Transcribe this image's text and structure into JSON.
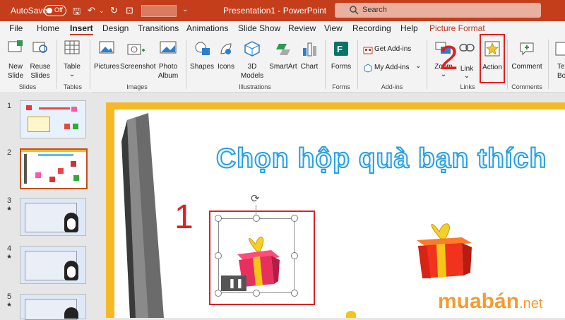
{
  "titlebar": {
    "autosave_label": "AutoSave",
    "autosave_state": "Off",
    "doc_title": "Presentation1 - PowerPoint",
    "search_placeholder": "Search"
  },
  "tabs": [
    "File",
    "Home",
    "Insert",
    "Design",
    "Transitions",
    "Animations",
    "Slide Show",
    "Review",
    "View",
    "Recording",
    "Help",
    "Picture Format"
  ],
  "active_tab": "Insert",
  "ribbon": {
    "new_slide": "New",
    "new_slide2": "Slide",
    "reuse": "Reuse",
    "reuse2": "Slides",
    "table": "Table",
    "pictures": "Pictures",
    "screenshot": "Screenshot",
    "photo": "Photo",
    "photo2": "Album",
    "shapes": "Shapes",
    "icons": "Icons",
    "models": "3D",
    "models2": "Models",
    "smartart": "SmartArt",
    "chart": "Chart",
    "forms": "Forms",
    "get_addins": "Get Add-ins",
    "my_addins": "My Add-ins",
    "zoom": "Zoom",
    "link": "Link",
    "action": "Action",
    "comment": "Comment",
    "textbox_partial": "Te",
    "textbox_partial2": "Bo",
    "groups": {
      "slides": "Slides",
      "tables": "Tables",
      "images": "Images",
      "illustrations": "Illustrations",
      "forms": "Forms",
      "addins": "Add-ins",
      "links": "Links",
      "comments": "Comments"
    }
  },
  "thumbnails": [
    {
      "num": "1",
      "star": ""
    },
    {
      "num": "2",
      "star": ""
    },
    {
      "num": "3",
      "star": "★"
    },
    {
      "num": "4",
      "star": "★"
    },
    {
      "num": "5",
      "star": "★"
    }
  ],
  "slide": {
    "title": "Chọn hộp quà bạn thích"
  },
  "annotations": {
    "step1": "1",
    "step2": "2"
  },
  "watermark": {
    "main": "muabán",
    "suffix": ".net"
  },
  "colors": {
    "accent": "#c43e1c",
    "highlight": "#e02020",
    "slide_border": "#f5b925"
  }
}
